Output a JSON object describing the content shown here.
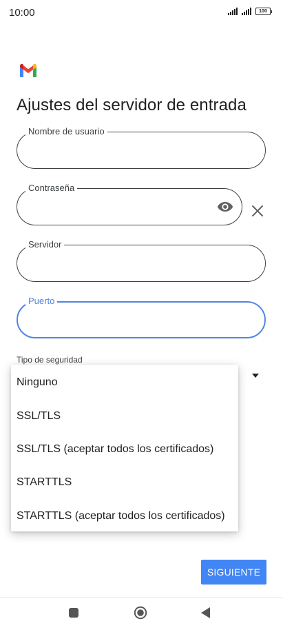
{
  "status_bar": {
    "time": "10:00",
    "battery": "100",
    "icons": [
      "signal-icon",
      "signal-icon",
      "battery-icon"
    ]
  },
  "app": {
    "logo_icon": "gmail-logo",
    "accent_color": "#4285f4",
    "focus_color": "#4f86e0"
  },
  "page": {
    "title": "Ajustes del servidor de entrada"
  },
  "form": {
    "username": {
      "label": "Nombre de usuario",
      "value": ""
    },
    "password": {
      "label": "Contraseña",
      "value": ""
    },
    "server": {
      "label": "Servidor",
      "value": ""
    },
    "port": {
      "label": "Puerto",
      "value": ""
    },
    "security": {
      "label": "Tipo de seguridad"
    }
  },
  "security_menu": {
    "options": [
      "Ninguno",
      "SSL/TLS",
      "SSL/TLS (aceptar todos los certificados)",
      "STARTTLS",
      "STARTTLS (aceptar todos los certificados)"
    ]
  },
  "actions": {
    "next_label": "SIGUIENTE"
  },
  "nav_bar": {
    "icons": [
      "recents-icon",
      "home-icon",
      "back-icon"
    ]
  }
}
